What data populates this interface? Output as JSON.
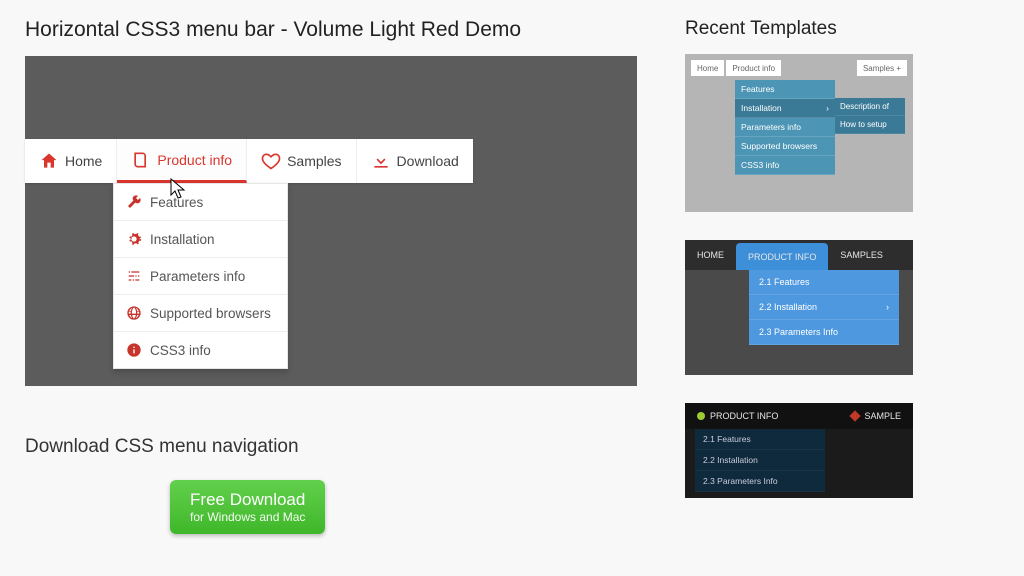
{
  "page_title": "Horizontal CSS3 menu bar - Volume Light Red Demo",
  "menu": {
    "items": [
      {
        "label": "Home",
        "icon": "home-icon"
      },
      {
        "label": "Product info",
        "icon": "book-icon"
      },
      {
        "label": "Samples",
        "icon": "heart-icon"
      },
      {
        "label": "Download",
        "icon": "download-icon"
      }
    ],
    "dropdown": [
      {
        "label": "Features",
        "icon": "wrench-icon"
      },
      {
        "label": "Installation",
        "icon": "gear-icon"
      },
      {
        "label": "Parameters info",
        "icon": "sliders-icon"
      },
      {
        "label": "Supported browsers",
        "icon": "globe-icon"
      },
      {
        "label": "CSS3 info",
        "icon": "info-icon"
      }
    ]
  },
  "download_section": {
    "title": "Download CSS menu navigation",
    "button": {
      "line1": "Free Download",
      "line2": "for Windows and Mac"
    }
  },
  "sidebar": {
    "title": "Recent Templates",
    "thumb1": {
      "top": [
        "Home",
        "Product info",
        "Samples  +"
      ],
      "sub": [
        "Features",
        "Installation",
        "Parameters info",
        "Supported browsers",
        "CSS3 info"
      ],
      "sub2": [
        "Description of",
        "How to setup"
      ]
    },
    "thumb2": {
      "top": [
        "HOME",
        "PRODUCT INFO",
        "SAMPLES"
      ],
      "sub": [
        "2.1 Features",
        "2.2 Installation",
        "2.3 Parameters Info"
      ]
    },
    "thumb3": {
      "top": [
        "PRODUCT INFO",
        "SAMPLE"
      ],
      "sub": [
        "2.1 Features",
        "2.2 Installation",
        "2.3 Parameters Info"
      ]
    }
  }
}
